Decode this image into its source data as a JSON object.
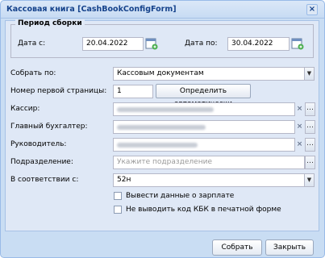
{
  "window": {
    "title": "Кассовая книга [CashBookConfigForm]"
  },
  "period": {
    "legend": "Период сборки",
    "date_from_label": "Дата с:",
    "date_from_value": "20.04.2022",
    "date_to_label": "Дата по:",
    "date_to_value": "30.04.2022"
  },
  "form": {
    "collect_by_label": "Собрать по:",
    "collect_by_value": "Кассовым документам",
    "first_page_label": "Номер первой страницы:",
    "first_page_value": "1",
    "auto_button": "Определить автоматически",
    "cashier_label": "Кассир:",
    "chief_accountant_label": "Главный бухгалтер:",
    "head_label": "Руководитель:",
    "department_label": "Подразделение:",
    "department_placeholder": "Укажите подразделение",
    "accordance_label": "В соответствии с:",
    "accordance_value": "52н",
    "salary_checkbox": "Вывести данные о зарплате",
    "kbk_checkbox": "Не выводить код КБК в печатной форме"
  },
  "footer": {
    "save": "Собрать",
    "close": "Закрыть"
  },
  "colors": {
    "window_border": "#99bbe8",
    "panel_bg": "#dfe8f6",
    "title_text": "#15428b"
  },
  "icons": {
    "close": "close-icon",
    "calendar": "calendar-icon",
    "dropdown": "chevron-down-icon",
    "clear": "clear-icon",
    "browse": "ellipsis-icon"
  }
}
